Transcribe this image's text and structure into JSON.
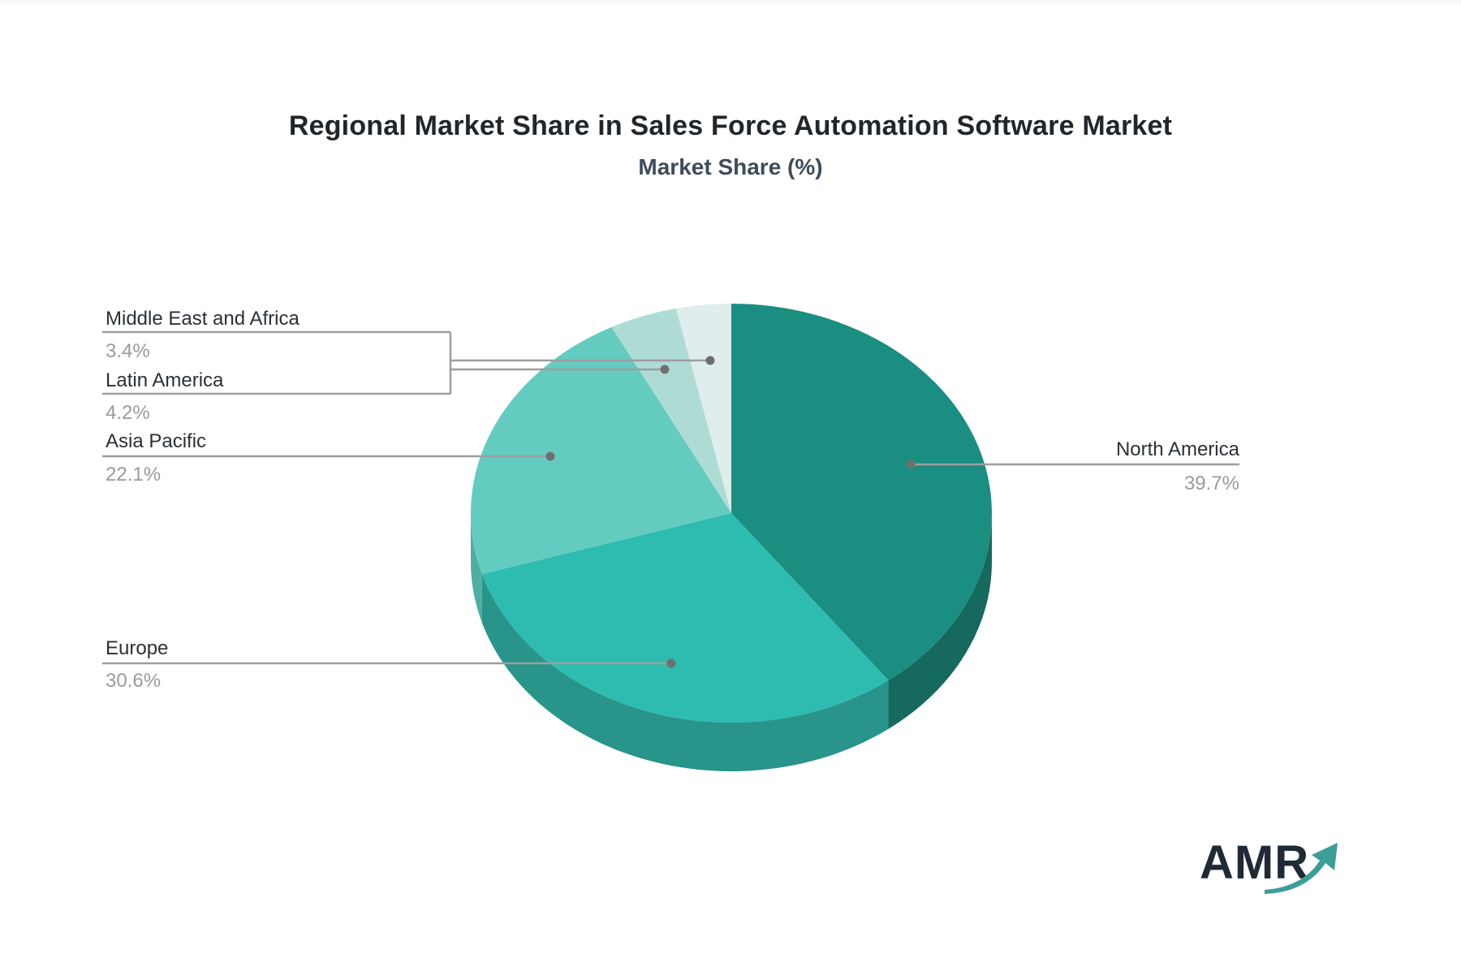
{
  "page": {
    "title": "Regional Market Share in Sales Force Automation Software Market",
    "subtitle": "Market Share (%)",
    "background": "#ffffff"
  },
  "logo": {
    "text": "AMR",
    "text_color": "#1e2a35",
    "arrow_color": "#3b9e97"
  },
  "chart_data": {
    "type": "pie",
    "style": "3d",
    "title": "Regional Market Share in Sales Force Automation Software Market",
    "subtitle": "Market Share (%)",
    "unit": "%",
    "direction": "clockwise",
    "start_angle_deg": 0,
    "categories": [
      "North America",
      "Europe",
      "Asia Pacific",
      "Latin America",
      "Middle East and Africa"
    ],
    "values": [
      39.7,
      30.6,
      22.1,
      4.2,
      3.4
    ],
    "value_labels": [
      "39.7%",
      "30.6%",
      "22.1%",
      "4.2%",
      "3.4%"
    ],
    "colors": [
      "#1a8e81",
      "#2ebcb1",
      "#64cbc0",
      "#aedcd4",
      "#dfeeec"
    ],
    "side_colors": [
      "#15695e",
      "#28948a",
      "#4fada2",
      "#8fc9c0",
      "#c2ddd9"
    ],
    "label_text_color": "#2b3035",
    "value_text_color": "#9a9a9a",
    "line_color": "#9e9e9e",
    "dot_color": "#6f6f6f",
    "legend": "callout-labels"
  }
}
